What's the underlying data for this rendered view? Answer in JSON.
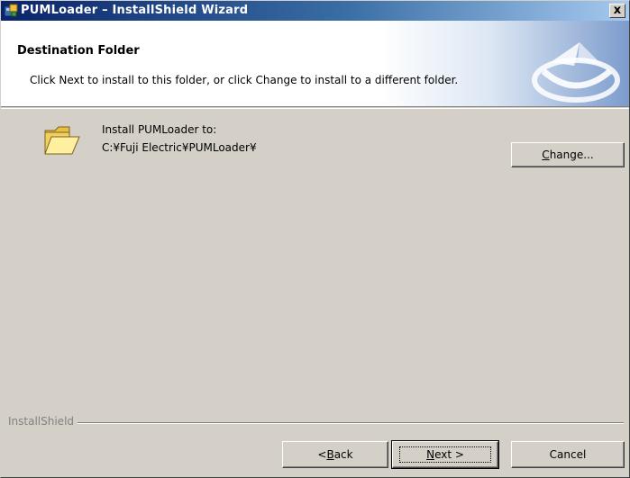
{
  "window": {
    "title": "PUMLoader – InstallShield Wizard",
    "close_label": "x",
    "title_icon": "installer-icon"
  },
  "banner": {
    "title": "Destination Folder",
    "subtitle": "Click Next to install to this folder, or click Change to install to a different folder.",
    "logo_icon": "installshield-logo-icon"
  },
  "content": {
    "folder_icon": "folder-icon",
    "install_label": "Install PUMLoader to:",
    "install_path": "C:¥Fuji Electric¥PUMLoader¥"
  },
  "buttons": {
    "change": {
      "mnemonic": "C",
      "rest": "hange..."
    },
    "back": {
      "prefix": "< ",
      "mnemonic": "B",
      "rest": "ack"
    },
    "next": {
      "mnemonic": "N",
      "rest": "ext >"
    },
    "cancel": "Cancel"
  },
  "footer": {
    "group_label": "InstallShield"
  },
  "colors": {
    "titlebar_start": "#0a246a",
    "titlebar_end": "#a6caf0",
    "dialog_face": "#d4d0c8",
    "banner_bg": "#ffffff"
  }
}
